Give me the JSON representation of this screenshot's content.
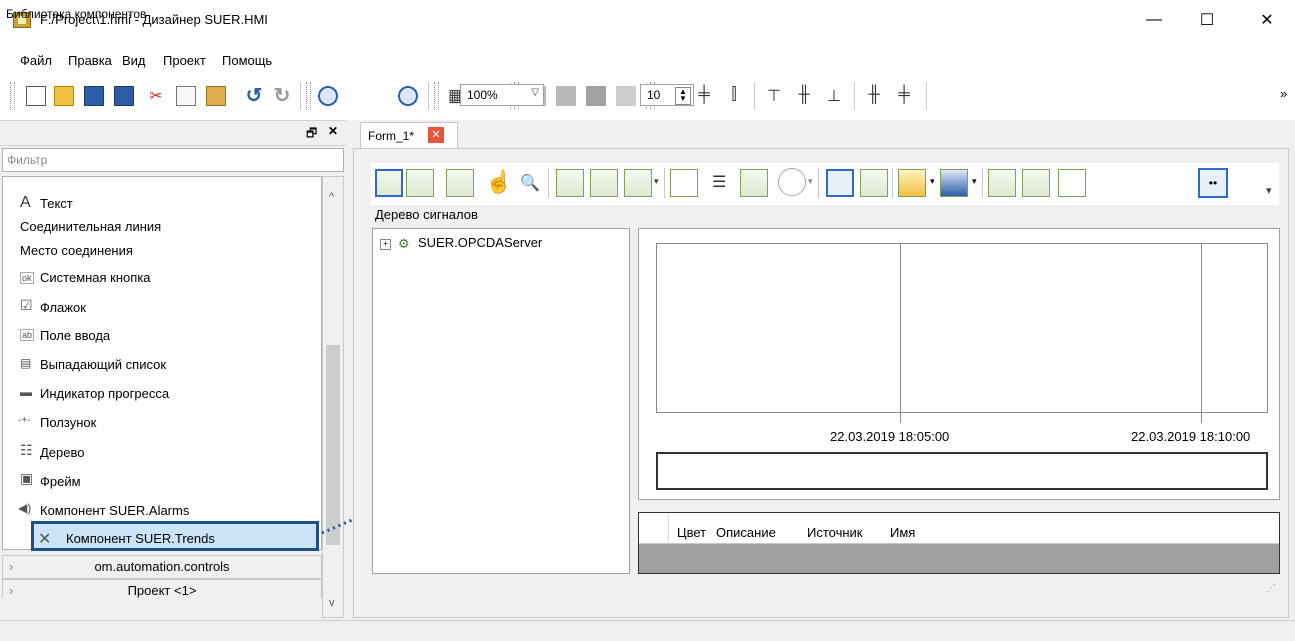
{
  "window": {
    "title": "F:/Project\\1.hmi - Дизайнер SUER.HMI",
    "minimize": "—",
    "maximize": "☐",
    "close": "✕"
  },
  "menu": [
    "Файл",
    "Правка",
    "Вид",
    "Проект",
    "Помощь"
  ],
  "toolbar": {
    "zoom_value": "100%",
    "grid_value": "10",
    "overflow": "»"
  },
  "library": {
    "title": "Библиотека компонентов",
    "pin": "🗗",
    "close": "✕",
    "filter_placeholder": "Фильтр",
    "items": [
      {
        "label": "Текст",
        "icon": "text-icon",
        "glyph": "A"
      },
      {
        "label": "Соединительная линия",
        "icon": "",
        "glyph": ""
      },
      {
        "label": "Место соединения",
        "icon": "",
        "glyph": ""
      },
      {
        "label": "Системная кнопка",
        "icon": "button-icon",
        "glyph": "ok"
      },
      {
        "label": "Флажок",
        "icon": "checkbox-icon",
        "glyph": "☑"
      },
      {
        "label": "Поле ввода",
        "icon": "input-field-icon",
        "glyph": "ab"
      },
      {
        "label": "Выпадающий список",
        "icon": "combobox-icon",
        "glyph": "▤"
      },
      {
        "label": "Индикатор прогресса",
        "icon": "progress-icon",
        "glyph": "▬"
      },
      {
        "label": "Ползунок",
        "icon": "slider-icon",
        "glyph": "-+-"
      },
      {
        "label": "Дерево",
        "icon": "tree-icon",
        "glyph": "☷"
      },
      {
        "label": "Фрейм",
        "icon": "frame-icon",
        "glyph": "▣"
      },
      {
        "label": "Компонент SUER.Alarms",
        "icon": "alarm-icon",
        "glyph": "◀)"
      },
      {
        "label": "Компонент SUER.Trends",
        "icon": "trends-icon",
        "glyph": "✕"
      }
    ],
    "groups": [
      "om.automation.controls",
      "Проект <1>"
    ]
  },
  "document": {
    "tab_label": "Form_1*",
    "signal_tree_label": "Дерево сигналов",
    "tree_root": "SUER.OPCDAServer",
    "x_labels": [
      "22.03.2019 18:05:00",
      "22.03.2019 18:10:00"
    ],
    "grid_columns": [
      "Цвет",
      "Описание",
      "Источник",
      "Имя"
    ]
  }
}
